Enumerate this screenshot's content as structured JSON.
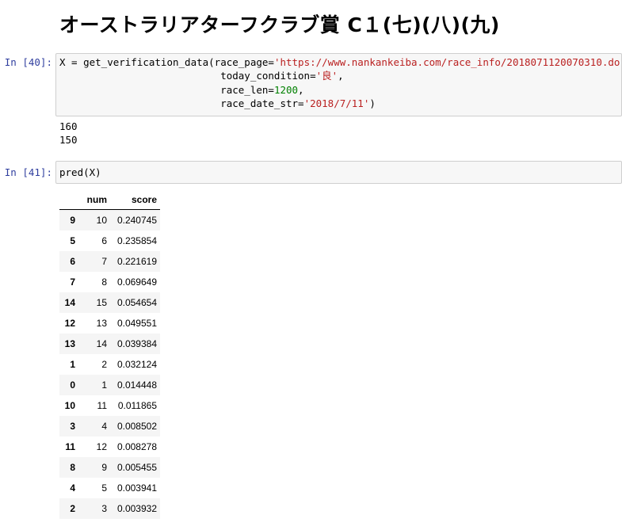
{
  "heading": "オーストラリアターフクラブ賞 C１(七)(八)(九)",
  "cell40": {
    "prompt": "In [40]:",
    "line1_pre": "X = get_verification_data(race_page=",
    "line1_str": "'https://www.nankankeiba.com/race_info/2018071120070310.do'",
    "line1_post": ",",
    "line2_pre": "                           today_condition=",
    "line2_str": "'良'",
    "line2_post": ",",
    "line3_pre": "                           race_len=",
    "line3_num": "1200",
    "line3_post": ",",
    "line4_pre": "                           race_date_str=",
    "line4_str": "'2018/7/11'",
    "line4_post": ")"
  },
  "stdout": [
    "160",
    "150"
  ],
  "cell41": {
    "prompt": "In [41]:",
    "code": "pred(X)"
  },
  "table": {
    "columns": [
      "",
      "num",
      "score"
    ],
    "rows": [
      {
        "index": "9",
        "num": "10",
        "score": "0.240745"
      },
      {
        "index": "5",
        "num": "6",
        "score": "0.235854"
      },
      {
        "index": "6",
        "num": "7",
        "score": "0.221619"
      },
      {
        "index": "7",
        "num": "8",
        "score": "0.069649"
      },
      {
        "index": "14",
        "num": "15",
        "score": "0.054654"
      },
      {
        "index": "12",
        "num": "13",
        "score": "0.049551"
      },
      {
        "index": "13",
        "num": "14",
        "score": "0.039384"
      },
      {
        "index": "1",
        "num": "2",
        "score": "0.032124"
      },
      {
        "index": "0",
        "num": "1",
        "score": "0.014448"
      },
      {
        "index": "10",
        "num": "11",
        "score": "0.011865"
      },
      {
        "index": "3",
        "num": "4",
        "score": "0.008502"
      },
      {
        "index": "11",
        "num": "12",
        "score": "0.008278"
      },
      {
        "index": "8",
        "num": "9",
        "score": "0.005455"
      },
      {
        "index": "4",
        "num": "5",
        "score": "0.003941"
      },
      {
        "index": "2",
        "num": "3",
        "score": "0.003932"
      }
    ]
  },
  "colors": {
    "prompt": "#303f9f",
    "string": "#ba2121",
    "number": "#008000",
    "cell_bg": "#f7f7f7"
  }
}
